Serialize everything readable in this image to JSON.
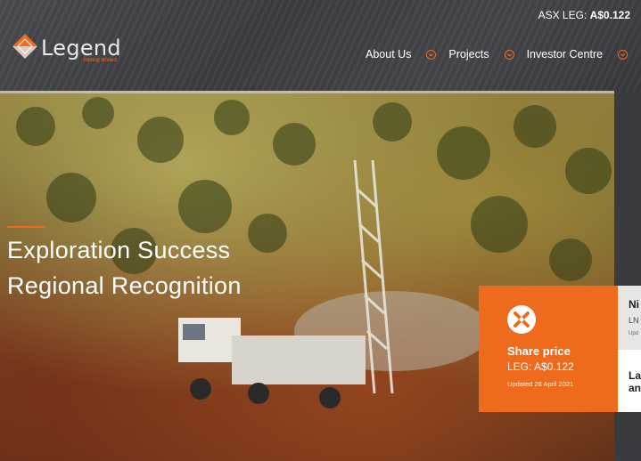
{
  "header": {
    "ticker_prefix": "ASX LEG:",
    "ticker_value": "A$0.122",
    "logo": {
      "word": "Legend",
      "tagline": "mining limited",
      "icon": "diamond-logo-icon"
    }
  },
  "nav": {
    "items": [
      {
        "label": "About Us",
        "icon": "chevron-down-icon"
      },
      {
        "label": "Projects",
        "icon": "chevron-down-icon"
      },
      {
        "label": "Investor Centre",
        "icon": "chevron-down-icon"
      }
    ]
  },
  "hero": {
    "line1": "Exploration Success",
    "line2": "Regional Recognition",
    "image": "drill-rig-photo"
  },
  "share_card": {
    "title": "Share price",
    "price": "LEG: A$0.122",
    "updated": "Updated 26 April 2021",
    "icon": "asx-logo-icon"
  },
  "news": {
    "card1": {
      "title": "Ni",
      "subtitle": "LN",
      "meta": "Upd"
    },
    "card2": {
      "line1": "La",
      "line2": "an"
    }
  },
  "colors": {
    "accent": "#ee6a1c",
    "header_bg": "#414246"
  }
}
